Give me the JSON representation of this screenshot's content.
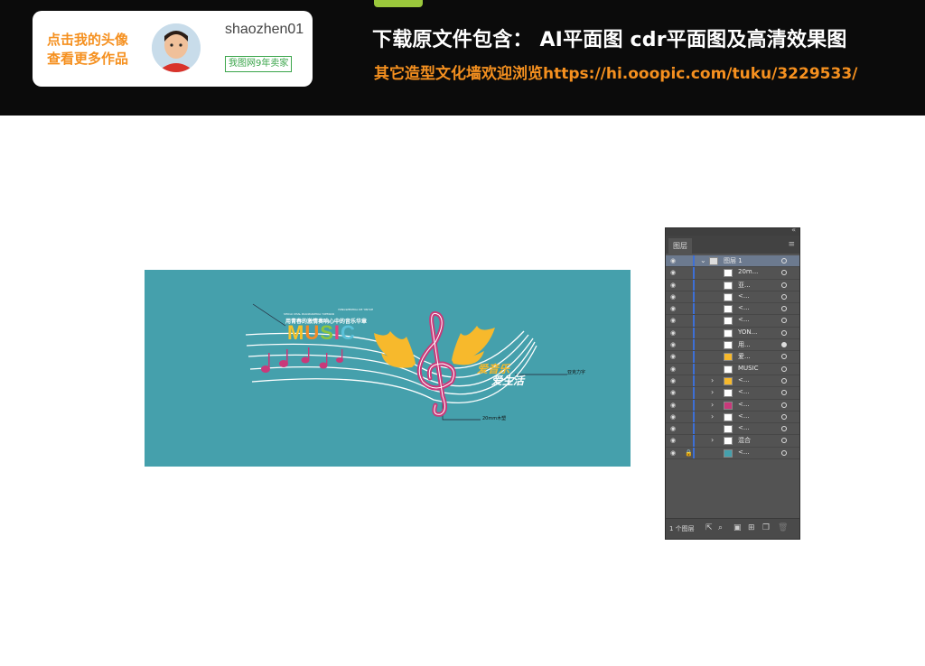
{
  "header": {
    "author_cta": "点击我的头像\n查看更多作品",
    "author_name": "shaozhen01",
    "seller_badge": "我图网9年卖家",
    "headline": "下载原文件包含：  AI平面图   cdr平面图及高清效果图",
    "subline": "其它造型文化墙欢迎浏览https://hi.ooopic.com/tuku/3229533/"
  },
  "artwork": {
    "english_small": "YONGWENHUA DE YINYUE",
    "english_small2": "SHICAI CHAL DIAOXIANHUA YUEMIAN",
    "slogan": "用青春的激情奏响心中的音乐华章",
    "title": "MUSIC",
    "phrase1": "爱音乐",
    "phrase2": "爱生活",
    "callout_right": "亚克力字",
    "callout_bottom": "20mm木塑",
    "title_colors": [
      "#f5c22a",
      "#f28c28",
      "#8ec63f",
      "#e6417c",
      "#5bc1d9"
    ],
    "background": "#45a0ac",
    "accent_pink": "#c9397a",
    "accent_yellow": "#f7b92c"
  },
  "layers_panel": {
    "tab": "图层",
    "layers": [
      {
        "label": "图层 1",
        "expanded": true,
        "selected": true,
        "arrow": "⌄",
        "locked": false
      },
      {
        "label": "20m...",
        "arrow": "",
        "locked": false
      },
      {
        "label": "亚...",
        "arrow": "",
        "locked": false
      },
      {
        "label": "<...",
        "arrow": "",
        "locked": false
      },
      {
        "label": "<...",
        "arrow": "",
        "locked": false
      },
      {
        "label": "<...",
        "arrow": "",
        "locked": false
      },
      {
        "label": "YON...",
        "arrow": "",
        "locked": false
      },
      {
        "label": "用...",
        "arrow": "",
        "locked": false
      },
      {
        "label": "爱...",
        "arrow": "",
        "locked": false
      },
      {
        "label": "MUSIC",
        "arrow": "",
        "locked": false
      },
      {
        "label": "<...",
        "arrow": "›",
        "locked": false
      },
      {
        "label": "<...",
        "arrow": "›",
        "locked": false
      },
      {
        "label": "<...",
        "arrow": "›",
        "locked": false
      },
      {
        "label": "<...",
        "arrow": "›",
        "locked": false
      },
      {
        "label": "<...",
        "arrow": "",
        "locked": false
      },
      {
        "label": "混合",
        "arrow": "›",
        "locked": false
      },
      {
        "label": "<...",
        "arrow": "",
        "locked": true
      }
    ],
    "footer_count": "1 个图层"
  }
}
